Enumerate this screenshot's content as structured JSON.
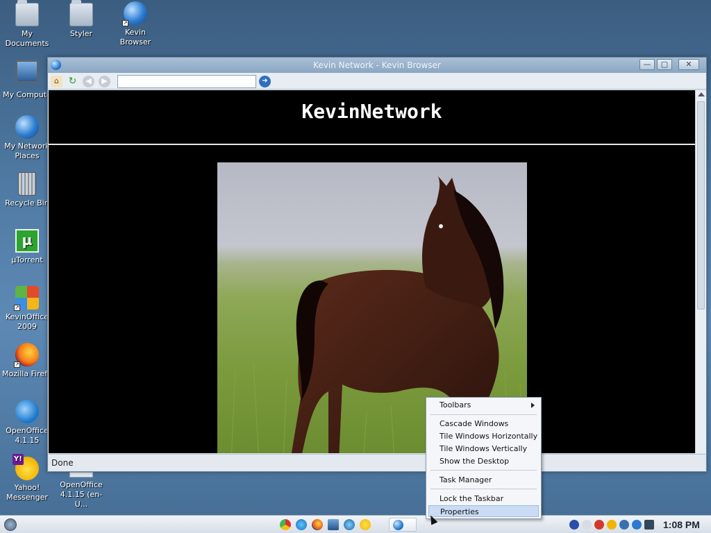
{
  "desktop": {
    "icons": [
      {
        "label": "My Documents",
        "icon": "folder-icon"
      },
      {
        "label": "Styler",
        "icon": "folder-icon"
      },
      {
        "label": "Kevin Browser",
        "icon": "globe-icon"
      },
      {
        "label": "My Compute",
        "icon": "computer-icon"
      },
      {
        "label": "My Network Places",
        "icon": "network-globe-icon"
      },
      {
        "label": "Recycle Bin",
        "icon": "recycle-bin-icon"
      },
      {
        "label": "µTorrent",
        "icon": "utorrent-icon"
      },
      {
        "label": "KevinOffice 2009",
        "icon": "office-icon"
      },
      {
        "label": "Mozilla Firefo",
        "icon": "firefox-icon"
      },
      {
        "label": "OpenOffice 4.1.15",
        "icon": "openoffice-icon"
      },
      {
        "label": "Yahoo! Messenger",
        "icon": "yahoo-messenger-icon"
      },
      {
        "label": "OpenOffice 4.1.15 (en-U...",
        "icon": "installer-icon"
      }
    ]
  },
  "window": {
    "title": "Kevin Network - Kevin Browser",
    "address_value": "",
    "site_title": "KevinNetwork",
    "image_alt": "horse",
    "status": "Done"
  },
  "context_menu": {
    "items": [
      {
        "label": "Toolbars",
        "submenu": true
      },
      {
        "label": "Cascade Windows"
      },
      {
        "label": "Tile Windows Horizontally"
      },
      {
        "label": "Tile Windows Vertically"
      },
      {
        "label": "Show the Desktop"
      },
      {
        "label": "Task Manager"
      },
      {
        "label": "Lock the Taskbar"
      },
      {
        "label": "Properties",
        "selected": true
      }
    ]
  },
  "taskbar": {
    "clock": "1:08 PM"
  }
}
